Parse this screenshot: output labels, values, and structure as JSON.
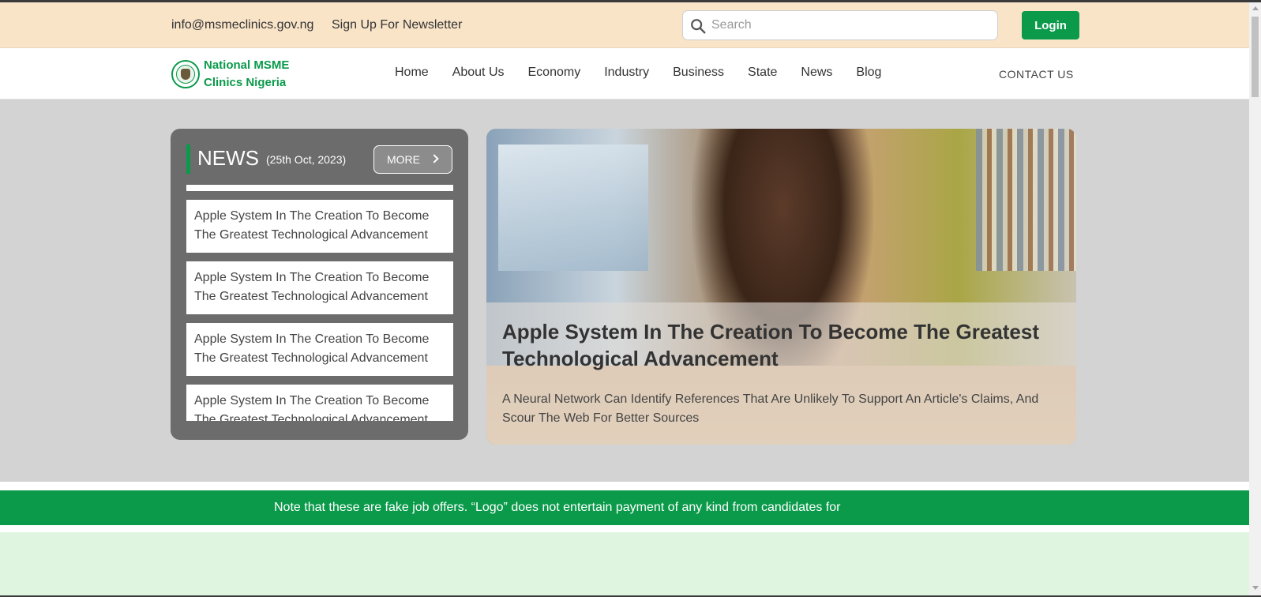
{
  "topbar": {
    "email": "info@msmeclinics.gov.ng",
    "newsletter": "Sign Up For Newsletter",
    "search_placeholder": "Search",
    "login_label": "Login"
  },
  "brand": {
    "name_line1": "National MSME",
    "name_line2": "Clinics Nigeria",
    "color": "#0a9a4a"
  },
  "nav": {
    "items": [
      "Home",
      "About Us",
      "Economy",
      "Industry",
      "Business",
      "State",
      "News",
      "Blog"
    ],
    "contact_label": "CONTACT US"
  },
  "news_panel": {
    "title": "NEWS",
    "date": "(25th Oct, 2023)",
    "more_label": "MORE",
    "items": [
      "Apple System In The Creation To Become The Greatest Technological Advancement",
      "Apple System In The Creation To Become The Greatest Technological Advancement",
      "Apple System In The Creation To Become The Greatest Technological Advancement",
      "Apple System In The Creation To Become The Greatest Technological Advancement"
    ]
  },
  "feature": {
    "title": "Apple System In The Creation To Become The Greatest Technological Advancement",
    "description": "A Neural Network Can Identify References That Are Unlikely To Support An Article's Claims, And Scour The Web For Better Sources"
  },
  "notice": {
    "text": "Note that these are fake job offers. “Logo” does not entertain payment of any kind from candidates for"
  },
  "colors": {
    "topbar_bg": "#f9e4c8",
    "hero_bg": "#d3d3d3",
    "accent_green": "#0a9a4a",
    "news_panel_bg": "#6c6c6c",
    "light_green": "#dff5e0"
  }
}
